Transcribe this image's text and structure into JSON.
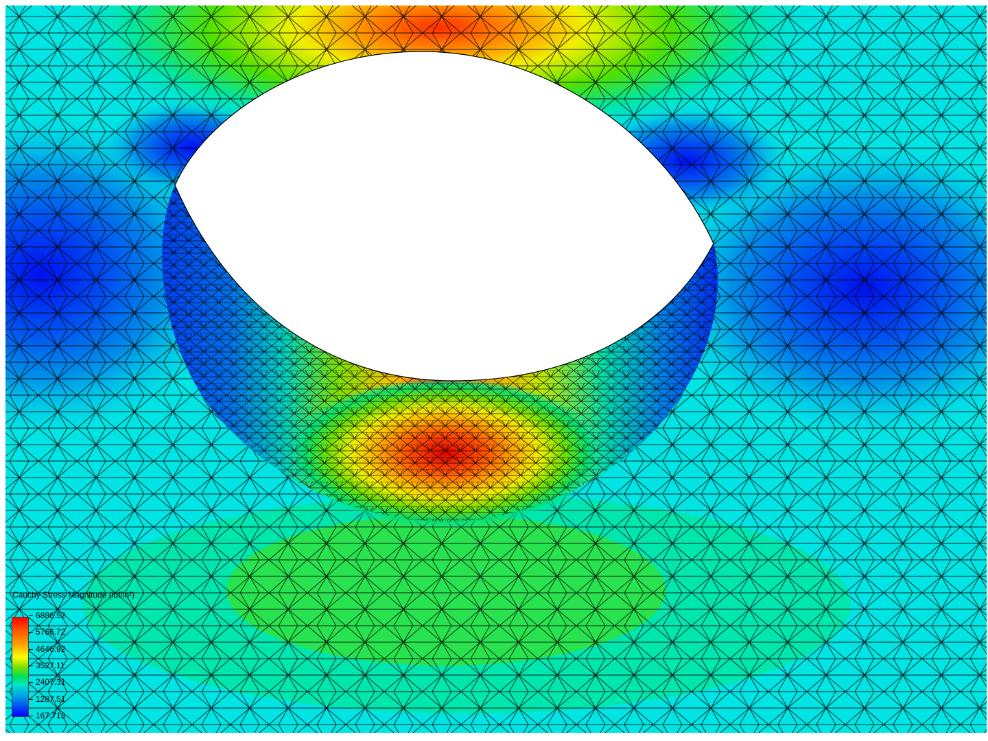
{
  "legend": {
    "title": "Cauchy Stress Magnitude (lbf/in²)",
    "labels": [
      "6886.52",
      "5766.72",
      "4646.92",
      "3527.11",
      "2407.31",
      "1287.51",
      "167.713"
    ]
  },
  "colors": {
    "background": "#ffffff",
    "mesh_lines": "#000000",
    "max_stress": "#ff0000",
    "min_stress": "#0000ff",
    "field_base": "#00e6e6"
  },
  "view": {
    "description_type": "finite element stress contour with hole",
    "mesh": "tetrahedral wireframe overlay"
  }
}
